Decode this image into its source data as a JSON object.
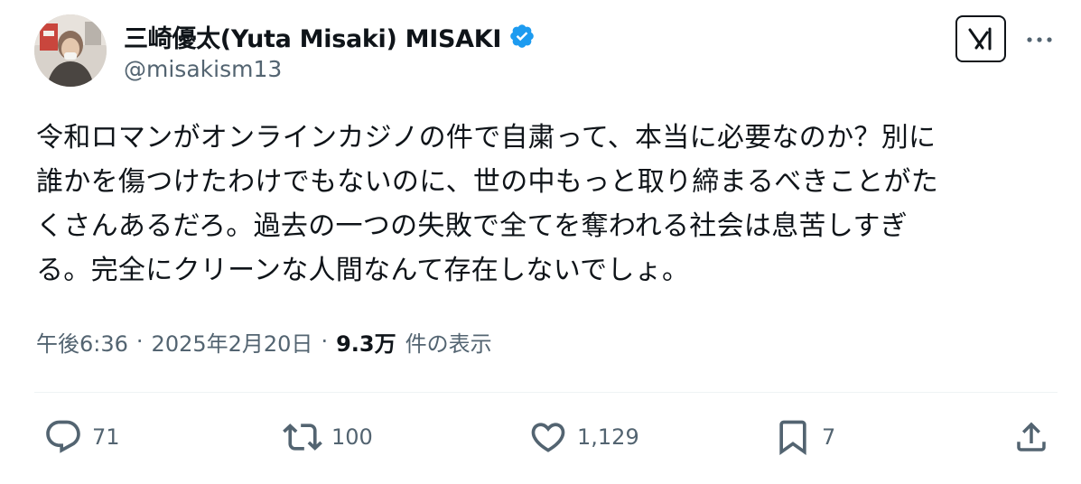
{
  "author": {
    "display_name": "三崎優太(Yuta Misaki) MISAKI",
    "handle": "@misakism13",
    "verified": true
  },
  "tweet": {
    "lines": [
      "令和ロマンがオンラインカジノの件で自粛って、本当に必要なのか？別に",
      "誰かを傷つけたわけでもないのに、世の中もっと取り締まるべきことがた",
      "くさんあるだろ。過去の一つの失敗で全てを奪われる社会は息苦しすぎ",
      "る。完全にクリーンな人間なんて存在しないでしょ。"
    ]
  },
  "meta": {
    "time": "午後6:36",
    "separator": "·",
    "date": "2025年2月20日",
    "views_count": "9.3万",
    "views_label": "件の表示"
  },
  "actions": {
    "reply_count": "71",
    "retweet_count": "100",
    "like_count": "1,129",
    "bookmark_count": "7"
  },
  "icons": {
    "verified": "verified-badge-icon",
    "grok": "grok-icon",
    "more": "more-icon",
    "reply": "reply-icon",
    "retweet": "retweet-icon",
    "like": "heart-icon",
    "bookmark": "bookmark-icon",
    "share": "share-icon"
  },
  "colors": {
    "text_primary": "#0f1419",
    "text_secondary": "#536471",
    "verified_blue": "#1d9bf0",
    "divider": "#eff3f4"
  }
}
